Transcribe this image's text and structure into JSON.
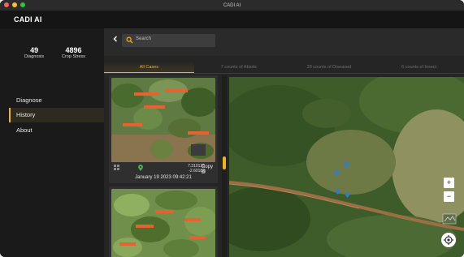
{
  "window": {
    "title": "CADI AI"
  },
  "app": {
    "name": "CADI AI",
    "accent": "#f1b31c"
  },
  "stats": [
    {
      "value": "49",
      "label": "Diagnosis"
    },
    {
      "value": "4896",
      "label": "Crop Stress"
    }
  ],
  "nav": [
    {
      "label": "Diagnose",
      "active": false
    },
    {
      "label": "History",
      "active": true
    },
    {
      "label": "About",
      "active": false
    }
  ],
  "search": {
    "placeholder": "Search"
  },
  "tabs": [
    {
      "label": "All Cases",
      "active": true
    },
    {
      "label": "7 counts of Abiotic",
      "active": false
    },
    {
      "label": "28 counts of Diseased",
      "active": false
    },
    {
      "label": "6 counts of Insect",
      "active": false
    }
  ],
  "cases": [
    {
      "coord_line1": "7.310125",
      "coord_line2": "-2.60182",
      "copy_label": "Copy",
      "date": "January 19 2023 09:42:21"
    }
  ],
  "map_controls": {
    "zoom_in": "+",
    "zoom_out": "−"
  },
  "icons": [
    "chevron-left-icon",
    "search-icon",
    "grid-icon",
    "location-pin-icon",
    "copy-icon",
    "layers-icon",
    "locate-icon",
    "map-marker-icon"
  ]
}
